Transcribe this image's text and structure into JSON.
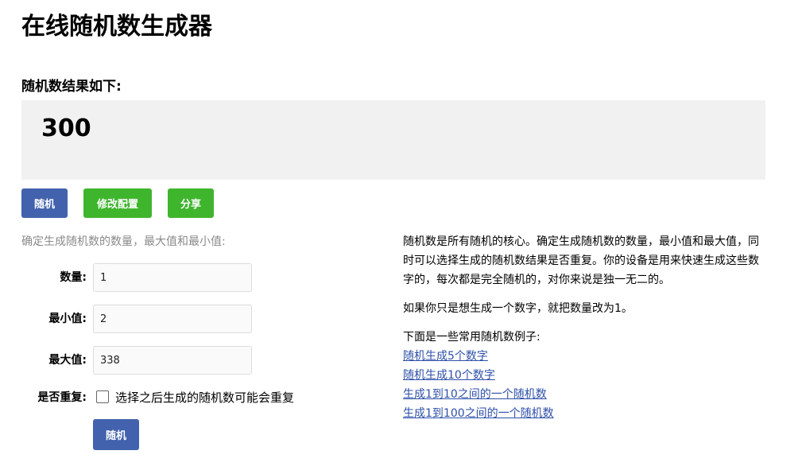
{
  "title": "在线随机数生成器",
  "result": {
    "label": "随机数结果如下:",
    "value": "300"
  },
  "actions": {
    "random_label": "随机",
    "config_label": "修改配置",
    "share_label": "分享"
  },
  "config": {
    "hint": "确定生成随机数的数量，最大值和最小值:",
    "count_label": "数量:",
    "count_value": "1",
    "min_label": "最小值:",
    "min_value": "2",
    "max_label": "最大值:",
    "max_value": "338",
    "repeat_label": "是否重复:",
    "repeat_checked": false,
    "repeat_text": "选择之后生成的随机数可能会重复",
    "submit_label": "随机"
  },
  "description": {
    "para1": "随机数是所有随机的核心。确定生成随机数的数量，最小值和最大值，同时可以选择生成的随机数结果是否重复。你的设备是用来快速生成这些数字的，每次都是完全随机的，对你来说是独一无二的。",
    "para2": "如果你只是想生成一个数字，就把数量改为1。",
    "examples_heading": "下面是一些常用随机数例子:",
    "examples": [
      "随机生成5个数字",
      "随机生成10个数字",
      "生成1到10之间的一个随机数",
      "生成1到100之间的一个随机数"
    ]
  },
  "colors": {
    "primary_button": "#4262ad",
    "secondary_button": "#3fb52d",
    "result_background": "#f1f1f1",
    "link": "#2d4fa8"
  }
}
